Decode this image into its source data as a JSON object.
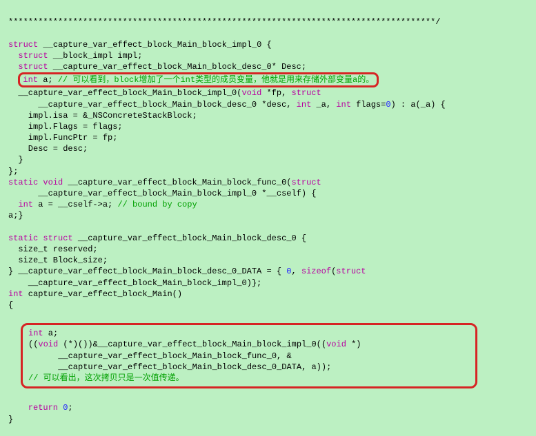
{
  "top": "**************************************************************************************/",
  "l1a": "struct",
  "l1b": " __capture_var_effect_block_Main_block_impl_0 {",
  "l2a": "  struct",
  "l2b": " __block_impl impl;",
  "l3a": "  struct",
  "l3b": " __capture_var_effect_block_Main_block_desc_0* Desc;",
  "hl1a": "int",
  "hl1b": " a; ",
  "hl1c": "// 可以看到，block增加了一个int类型的成员变量，他就是用来存储外部变量a的。",
  "l5a": "  __capture_var_effect_block_Main_block_impl_0(",
  "l5b": "void",
  "l5c": " *fp, ",
  "l5d": "struct",
  "l5e": "\n      __capture_var_effect_block_Main_block_desc_0 *desc, ",
  "l5f": "int",
  "l5g": " _a, ",
  "l5h": "int",
  "l5i": " flags=",
  "l5j": "0",
  "l5k": ") : a(_a) {",
  "l6": "    impl.isa = &_NSConcreteStackBlock;",
  "l7": "    impl.Flags = flags;",
  "l8": "    impl.FuncPtr = fp;",
  "l9": "    Desc = desc;",
  "l10": "  }",
  "l11": "};",
  "l12a": "static void",
  "l12b": " __capture_var_effect_block_Main_block_func_0(",
  "l12c": "struct",
  "l12d": "\n      __capture_var_effect_block_Main_block_impl_0 *__cself) {",
  "l13a": "  int",
  "l13b": " a = __cself->a; ",
  "l13c": "// bound by copy",
  "l14": "a;}",
  "l15": "",
  "l16a": "static struct",
  "l16b": " __capture_var_effect_block_Main_block_desc_0 {",
  "l17": "  size_t reserved;",
  "l18": "  size_t Block_size;",
  "l19a": "} __capture_var_effect_block_Main_block_desc_0_DATA = { ",
  "l19b": "0",
  "l19c": ", ",
  "l19d": "sizeof",
  "l19e": "(",
  "l19f": "struct",
  "l19g": "\n    __capture_var_effect_block_Main_block_impl_0)};",
  "l20a": "int",
  "l20b": " capture_var_effect_block_Main()",
  "l21": "{",
  "l22": "",
  "box1a": "int",
  "box1b": " a;",
  "box2a": "((",
  "box2b": "void",
  "box2c": " (*)())&__capture_var_effect_block_Main_block_impl_0((",
  "box2d": "void",
  "box2e": " *)",
  "box3": "      __capture_var_effect_block_Main_block_func_0, &",
  "box4": "      __capture_var_effect_block_Main_block_desc_0_DATA, a));",
  "box5": "// 可以看出，这次拷贝只是一次值传递。",
  "l30a": "    return",
  "l30b": " ",
  "l30c": "0",
  "l30d": ";",
  "l31": "}"
}
